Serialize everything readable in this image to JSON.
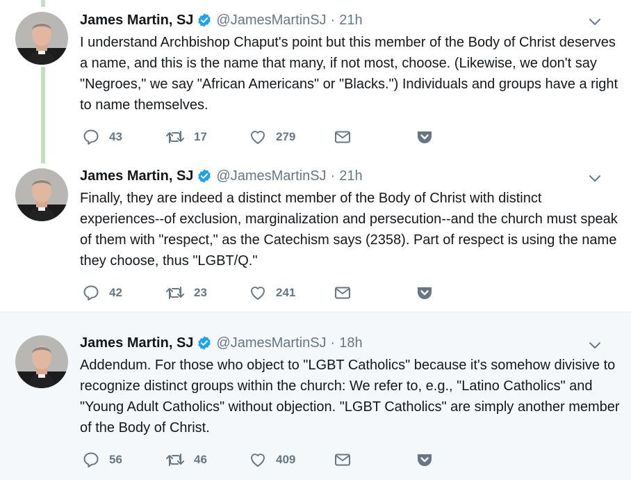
{
  "colors": {
    "thread_line": "#c4e0c2",
    "verified_blue": "#1da1f2",
    "secondary_text": "#657786",
    "highlight_bg": "#f5f8fa"
  },
  "tweets": [
    {
      "name": "James Martin, SJ",
      "handle": "@JamesMartinSJ",
      "separator": "·",
      "time": "21h",
      "text": "I understand Archbishop Chaput's point but this member of the Body of Christ deserves a name, and this is the name that many, if not most, choose. (Likewise, we don't say \"Negroes,\" we say \"African Americans\" or \"Blacks.\") Individuals and groups have a right to name themselves.",
      "replies": "43",
      "retweets": "17",
      "likes": "279"
    },
    {
      "name": "James Martin, SJ",
      "handle": "@JamesMartinSJ",
      "separator": "·",
      "time": "21h",
      "text": "Finally, they are indeed a distinct member of the Body of Christ with distinct experiences--of exclusion, marginalization and persecution--and the church must speak of them with \"respect,\" as the Catechism says (2358). Part of respect is using the name they choose, thus \"LGBT/Q.\"",
      "replies": "42",
      "retweets": "23",
      "likes": "241"
    },
    {
      "name": "James Martin, SJ",
      "handle": "@JamesMartinSJ",
      "separator": "·",
      "time": "18h",
      "text": "Addendum. For those who object to \"LGBT Catholics\" because it's somehow divisive to recognize distinct groups within the church: We refer to, e.g., \"Latino Catholics\" and \"Young Adult Catholics\" without objection. \"LGBT Catholics\" are simply another member of the Body of Christ.",
      "replies": "56",
      "retweets": "46",
      "likes": "409"
    }
  ]
}
